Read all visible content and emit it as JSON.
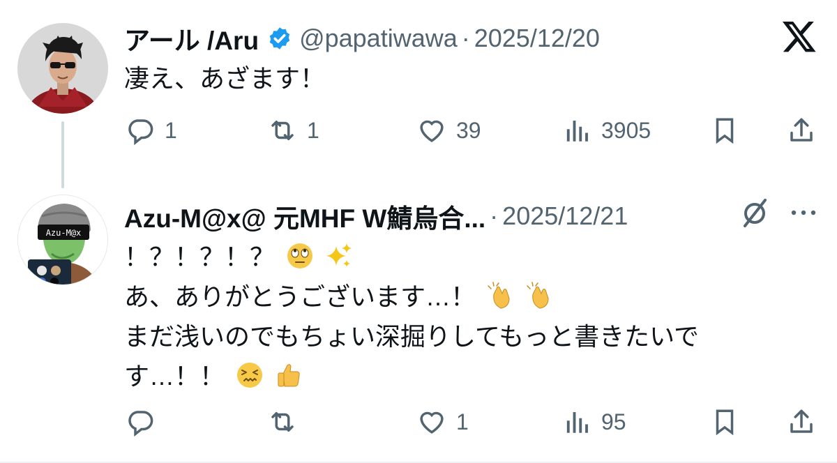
{
  "tweets": [
    {
      "author_name": "アール /Aru",
      "verified": true,
      "handle": "@papatiwawa",
      "separator": "·",
      "date": "2025/12/20",
      "text_lines": [
        "凄え、あざます！"
      ],
      "actions": {
        "replies": "1",
        "retweets": "1",
        "likes": "39",
        "views": "3905"
      }
    },
    {
      "author_name": "Azu-M@x@ 元MHF W鯖烏合...",
      "handle": "",
      "separator": "·",
      "date": "2025/12/21",
      "text_lines": [
        "！？！？！？",
        "あ、ありがとうございます…！",
        "まだ浅いのでもちょい深掘りしてもっと書きたいで",
        "す…！！"
      ],
      "actions": {
        "replies": "",
        "retweets": "",
        "likes": "1",
        "views": "95"
      },
      "avatar_text": "Azu-M@x"
    }
  ],
  "icons": {
    "platform_logo": "x-logo-icon",
    "grok": "grok-icon",
    "more": "more-icon"
  },
  "colors": {
    "text_primary": "#0f1419",
    "text_secondary": "#536471",
    "verified_blue": "#1d9bf0",
    "thread_line": "#cfd9de"
  }
}
